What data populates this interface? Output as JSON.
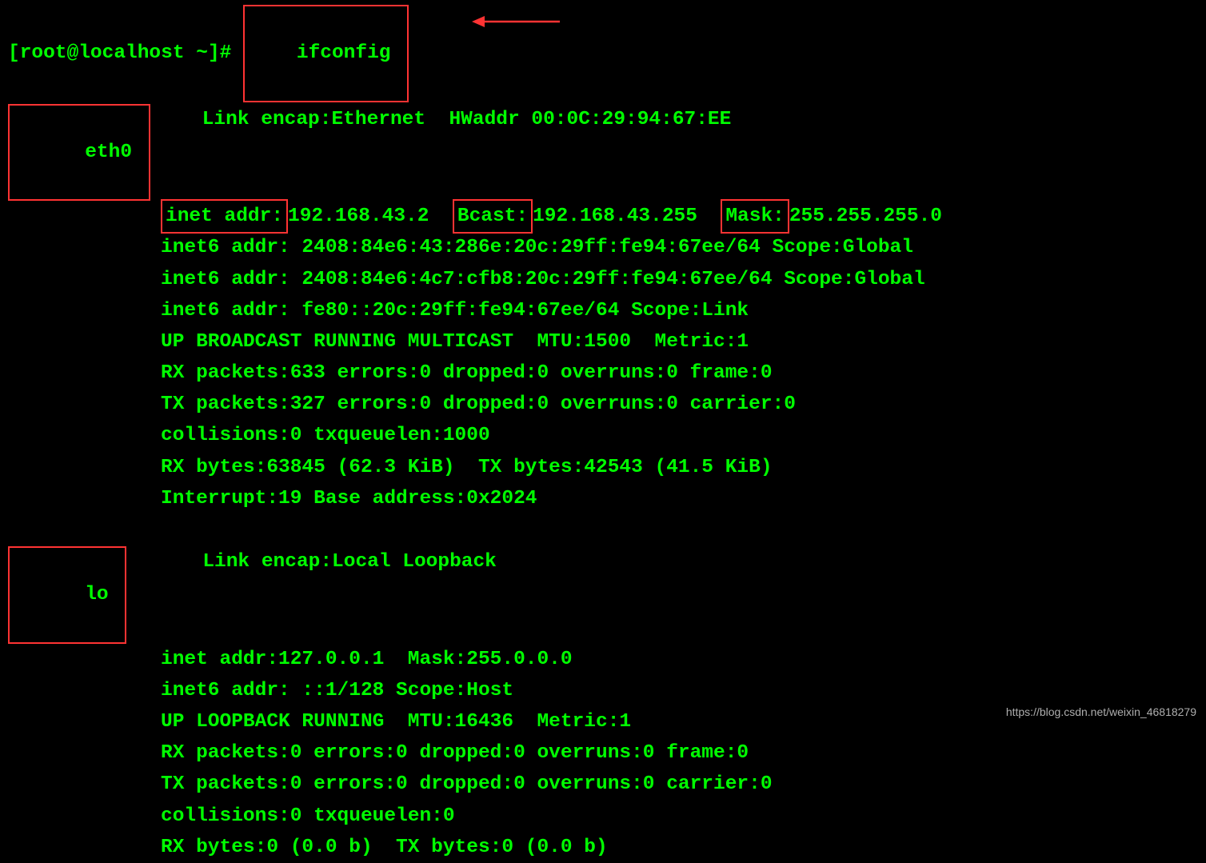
{
  "prompt": "[root@localhost ~]# ",
  "command": "ifconfig ",
  "interfaces": [
    {
      "name": "eth0",
      "name_pad": "eth0 ",
      "first_line": "Link encap:Ethernet  HWaddr 00:0C:29:94:67:EE",
      "inet_addr_label": "inet addr:",
      "inet_addr_value": "192.168.43.2  ",
      "bcast_label": "Bcast:",
      "bcast_value": "192.168.43.255  ",
      "mask_label": "Mask:",
      "mask_value": "255.255.255.0",
      "lines": [
        "inet6 addr: 2408:84e6:43:286e:20c:29ff:fe94:67ee/64 Scope:Global",
        "inet6 addr: 2408:84e6:4c7:cfb8:20c:29ff:fe94:67ee/64 Scope:Global",
        "inet6 addr: fe80::20c:29ff:fe94:67ee/64 Scope:Link",
        "UP BROADCAST RUNNING MULTICAST  MTU:1500  Metric:1",
        "RX packets:633 errors:0 dropped:0 overruns:0 frame:0",
        "TX packets:327 errors:0 dropped:0 overruns:0 carrier:0",
        "collisions:0 txqueuelen:1000",
        "RX bytes:63845 (62.3 KiB)  TX bytes:42543 (41.5 KiB)",
        "Interrupt:19 Base address:0x2024"
      ]
    },
    {
      "name": "lo",
      "name_pad": "lo ",
      "first_line": "Link encap:Local Loopback",
      "lines_plain": [
        "inet addr:127.0.0.1  Mask:255.0.0.0",
        "inet6 addr: ::1/128 Scope:Host",
        "UP LOOPBACK RUNNING  MTU:16436  Metric:1",
        "RX packets:0 errors:0 dropped:0 overruns:0 frame:0",
        "TX packets:0 errors:0 dropped:0 overruns:0 carrier:0",
        "collisions:0 txqueuelen:0",
        "RX bytes:0 (0.0 b)  TX bytes:0 (0.0 b)"
      ]
    }
  ],
  "watermark": "https://blog.csdn.net/weixin_46818279"
}
